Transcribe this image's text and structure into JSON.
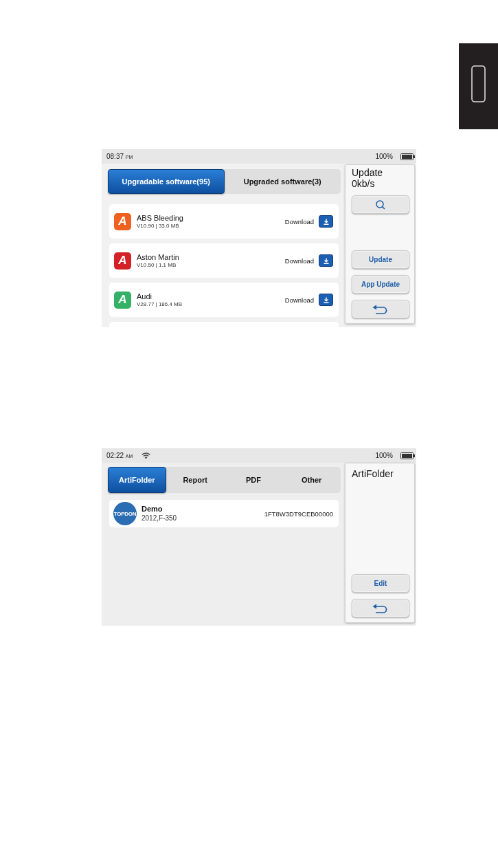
{
  "screenshots": [
    {
      "status_bar": {
        "time": "08:37",
        "meridiem": "PM",
        "battery": "100%"
      },
      "tabs": [
        {
          "label": "Upgradable software(95)",
          "selected": true
        },
        {
          "label": "Upgraded software(3)",
          "selected": false
        }
      ],
      "software_list": {
        "more_below": true,
        "items": [
          {
            "icon_letter": "A",
            "color": "#ee6121",
            "name": "ABS Bleeding",
            "details": "V10.90 | 33.0 MB",
            "action": "Download"
          },
          {
            "icon_letter": "A",
            "color": "#d42027",
            "name": "Aston Martin",
            "details": "V10.50 | 1.1 MB",
            "action": "Download"
          },
          {
            "icon_letter": "A",
            "color": "#35b167",
            "name": "Audi",
            "details": "V28.77 | 186.4 MB",
            "action": "Download"
          }
        ]
      },
      "side_panel": {
        "title_lines": [
          "Update",
          "0kb/s"
        ],
        "top_buttons": [
          {
            "kind": "search"
          }
        ],
        "bottom_buttons": [
          {
            "kind": "text",
            "label": "Update"
          },
          {
            "kind": "text",
            "label": "App Update"
          },
          {
            "kind": "back"
          }
        ]
      }
    },
    {
      "status_bar": {
        "time": "02:22",
        "meridiem": "AM",
        "wifi": true,
        "battery": "100%"
      },
      "tabs": [
        {
          "label": "ArtiFolder",
          "selected": true
        },
        {
          "label": "Report",
          "selected": false
        },
        {
          "label": "PDF",
          "selected": false
        },
        {
          "label": "Other",
          "selected": false
        }
      ],
      "record_list": {
        "items": [
          {
            "logo_text": "TOPDON",
            "name": "Demo",
            "vehicle": "2012,F-350",
            "vin": "1FT8W3DT9CEB00000"
          }
        ]
      },
      "side_panel": {
        "title_lines": [
          "ArtiFolder"
        ],
        "bottom_buttons": [
          {
            "kind": "text",
            "label": "Edit"
          },
          {
            "kind": "back"
          }
        ]
      }
    }
  ]
}
